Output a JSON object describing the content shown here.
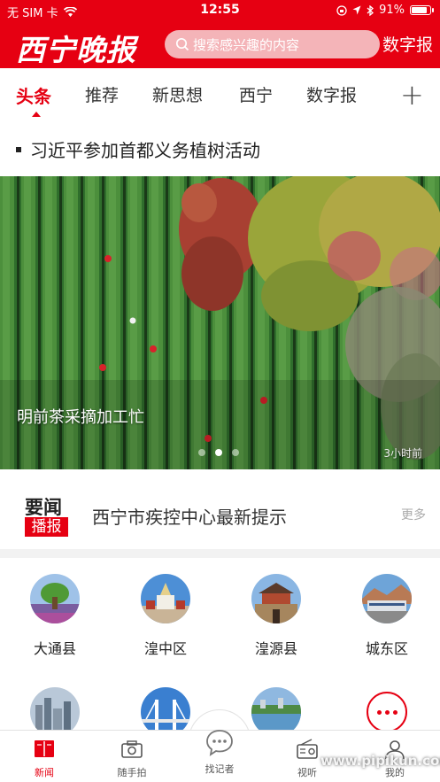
{
  "status_bar": {
    "carrier": "无 SIM 卡",
    "time": "12:55",
    "battery": "91%",
    "battery_level": 0.91
  },
  "header": {
    "logo_text": "西宁晚报",
    "search_placeholder": "搜索感兴趣的内容",
    "digital_label": "数字报"
  },
  "tabs": [
    {
      "label": "头条",
      "active": true
    },
    {
      "label": "推荐"
    },
    {
      "label": "新思想"
    },
    {
      "label": "西宁"
    },
    {
      "label": "数字报"
    }
  ],
  "headline": "习近平参加首都义务植树活动",
  "banner": {
    "caption": "明前茶采摘加工忙",
    "time": "3小时前",
    "page_count": 3,
    "active_page": 2
  },
  "news_strip": {
    "badge_top": "要闻",
    "badge_bottom": "播报",
    "title": "西宁市疾控中心最新提示",
    "more": "更多"
  },
  "districts": [
    {
      "label": "大通县",
      "icon": "datong-photo"
    },
    {
      "label": "湟中区",
      "icon": "huangzhong-photo"
    },
    {
      "label": "湟源县",
      "icon": "huangyuan-photo"
    },
    {
      "label": "城东区",
      "icon": "chengdong-photo"
    }
  ],
  "bottom_nav": [
    {
      "label": "新闻",
      "icon": "book-icon",
      "active": true
    },
    {
      "label": "随手拍",
      "icon": "camera-icon"
    },
    {
      "label": "找记者",
      "icon": "chat-bubble-icon"
    },
    {
      "label": "视听",
      "icon": "radio-icon"
    },
    {
      "label": "我的",
      "icon": "user-icon"
    }
  ],
  "watermark": "www.pipikun.com",
  "colors": {
    "brand_red": "#e60012"
  }
}
